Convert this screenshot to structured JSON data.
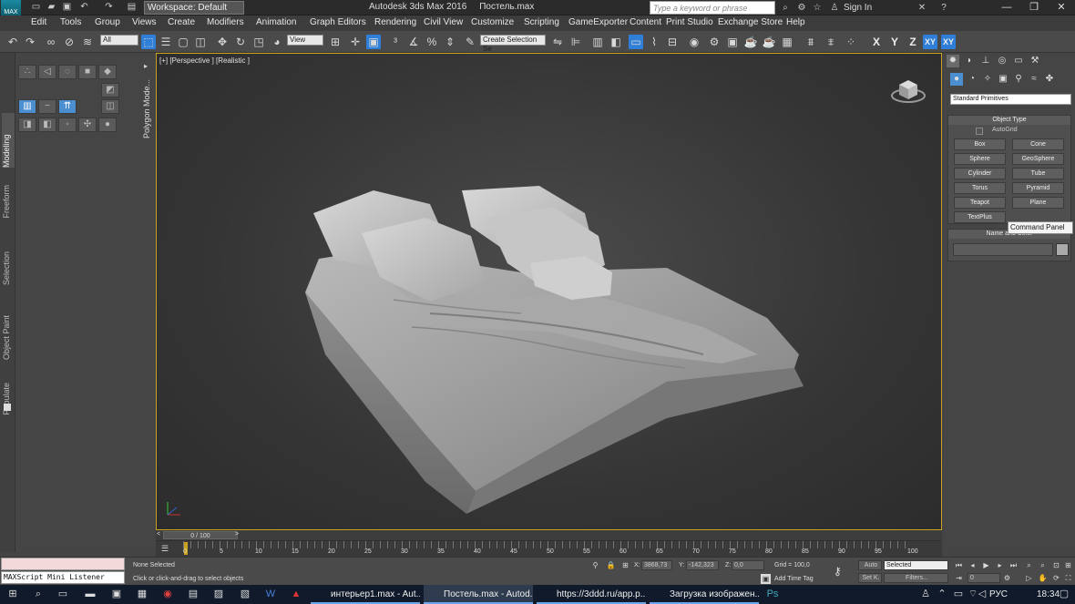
{
  "titlebar": {
    "app_logo_text": "MAX",
    "workspace": "Workspace: Default",
    "app_name": "Autodesk 3ds Max 2016",
    "file_name": "Постель.max",
    "search_placeholder": "Type a keyword or phrase",
    "sign_in": "Sign In",
    "icons": [
      "new-file-icon",
      "open-icon",
      "save-icon",
      "undo-icon",
      "redo-icon",
      "project-icon"
    ]
  },
  "menu": [
    "Edit",
    "Tools",
    "Group",
    "Views",
    "Create",
    "Modifiers",
    "Animation",
    "Graph Editors",
    "Rendering",
    "Civil View",
    "Customize",
    "Scripting",
    "GameExporter",
    "Content",
    "Print Studio",
    "Exchange Store",
    "Help"
  ],
  "toolbar": {
    "selection_filter": "All",
    "ref_coord": "View",
    "named_selection": "Create Selection Se",
    "axis_x": "X",
    "axis_y": "Y",
    "axis_z": "Z",
    "axis_xy": "XY",
    "axis_xy2": "XY"
  },
  "ribbon": {
    "tabs": [
      "Modeling",
      "Freeform",
      "Selection",
      "Object Paint",
      "Populate"
    ],
    "panel_label": "Polygon Mode..."
  },
  "viewport": {
    "label": "[+] [Perspective ] [Realistic ]"
  },
  "command_panel": {
    "dropdown": "Standard Primitives",
    "object_type_title": "Object Type",
    "autogrid": "AutoGrid",
    "primitives": [
      "Box",
      "Cone",
      "Sphere",
      "GeoSphere",
      "Cylinder",
      "Tube",
      "Torus",
      "Pyramid",
      "Teapot",
      "Plane",
      "TextPlus"
    ],
    "name_color_title": "Name and Color",
    "tooltip": "Command Panel"
  },
  "timeline": {
    "slider_label": "0 / 100",
    "ticks": [
      "0",
      "5",
      "10",
      "15",
      "20",
      "25",
      "30",
      "35",
      "40",
      "45",
      "50",
      "55",
      "60",
      "65",
      "70",
      "75",
      "80",
      "85",
      "90",
      "95",
      "100"
    ]
  },
  "status": {
    "maxscript": "MAXScript Mini Listener",
    "selection": "None Selected",
    "prompt": "Click or click-and-drag to select objects",
    "x_label": "X:",
    "x_value": "3868,73",
    "y_label": "Y:",
    "y_value": "-142,323",
    "z_label": "Z:",
    "z_value": "0,0",
    "grid": "Grid = 100,0",
    "add_time_tag": "Add Time Tag",
    "auto": "Auto",
    "set_key": "Set K.",
    "selected": "Selected",
    "filters": "Filters...",
    "frame": "0"
  },
  "taskbar": {
    "windows": [
      {
        "label": "интерьер1.max - Aut..."
      },
      {
        "label": "Постель.max - Autod..."
      },
      {
        "label": "https://3ddd.ru/app.p..."
      },
      {
        "label": "Загрузка изображен..."
      }
    ],
    "language": "РУС",
    "time": "18:34"
  }
}
